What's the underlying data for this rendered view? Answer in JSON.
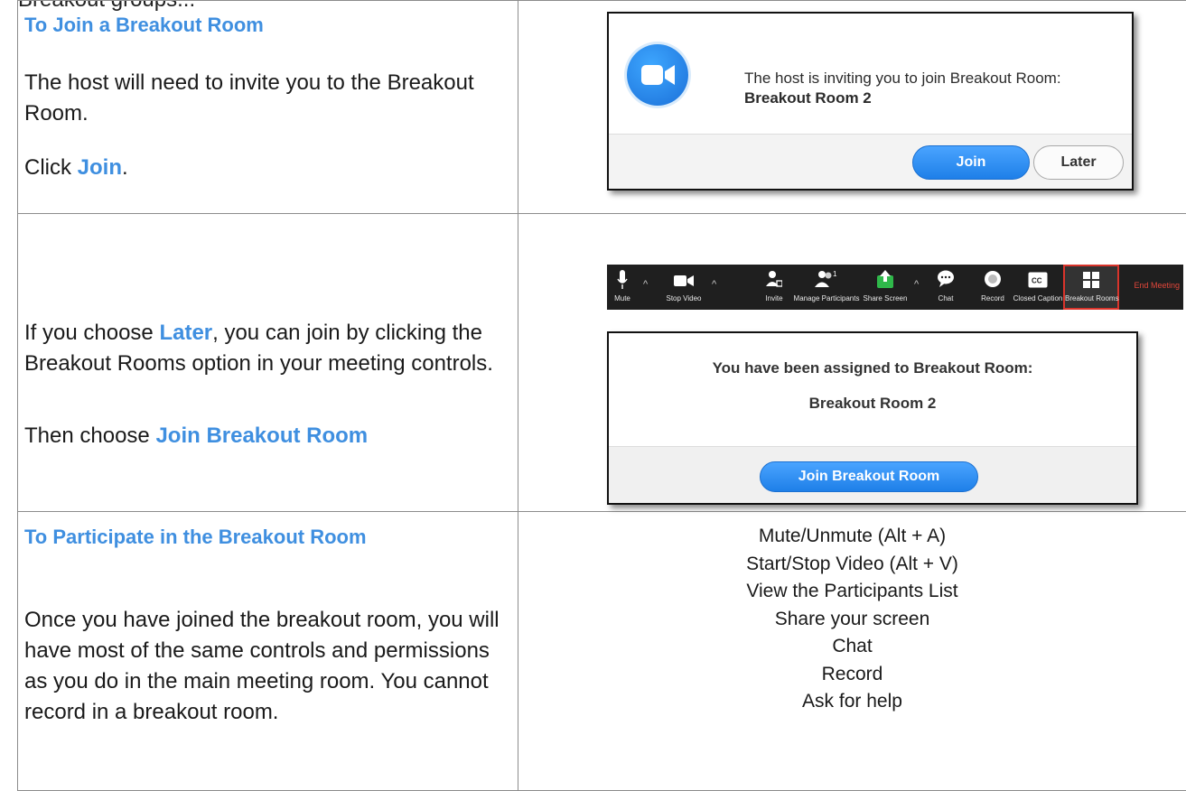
{
  "stub_text": "Breakout groups...",
  "row1": {
    "heading": "To Join a Breakout Room",
    "para1": "The host will need to invite you to the Breakout Room.",
    "click_prefix": "Click ",
    "click_keyword": "Join",
    "click_suffix": ".",
    "dialog": {
      "icon": "zoom-camera-icon",
      "message": "The host is inviting you to join Breakout Room:",
      "room_name": "Breakout Room 2",
      "join_label": "Join",
      "later_label": "Later"
    }
  },
  "row2": {
    "para1_prefix": "If you choose ",
    "para1_keyword": "Later",
    "para1_suffix": ", you can join by clicking the Breakout Rooms option in your meeting controls.",
    "para2_prefix": "Then choose ",
    "para2_keyword": "Join Breakout Room",
    "toolbar": {
      "mute": "Mute",
      "stop_video": "Stop Video",
      "invite": "Invite",
      "manage_participants": "Manage Participants",
      "participant_count": "1",
      "share_screen": "Share Screen",
      "chat": "Chat",
      "record": "Record",
      "closed_caption": "Closed Caption",
      "cc_badge": "CC",
      "breakout_rooms": "Breakout Rooms",
      "end_meeting": "End Meeting"
    },
    "dialog": {
      "message": "You have been assigned to Breakout Room:",
      "room_name": "Breakout Room 2",
      "button_label": "Join Breakout Room"
    }
  },
  "row3": {
    "heading": "To Participate in the Breakout Room",
    "para": "Once you have joined the breakout room, you will have most of the same controls and permissions as you do in the main meeting room. You cannot record in a breakout room.",
    "controls": [
      "Mute/Unmute (Alt + A)",
      "Start/Stop Video (Alt + V)",
      "View the Participants List",
      "Share your screen",
      "Chat",
      "Record",
      "Ask for help"
    ]
  },
  "colors": {
    "accent_blue": "#3f8fe0",
    "button_blue": "#1e7fe8",
    "highlight_red": "#d9342b",
    "toolbar_bg": "#1f1f1f"
  }
}
